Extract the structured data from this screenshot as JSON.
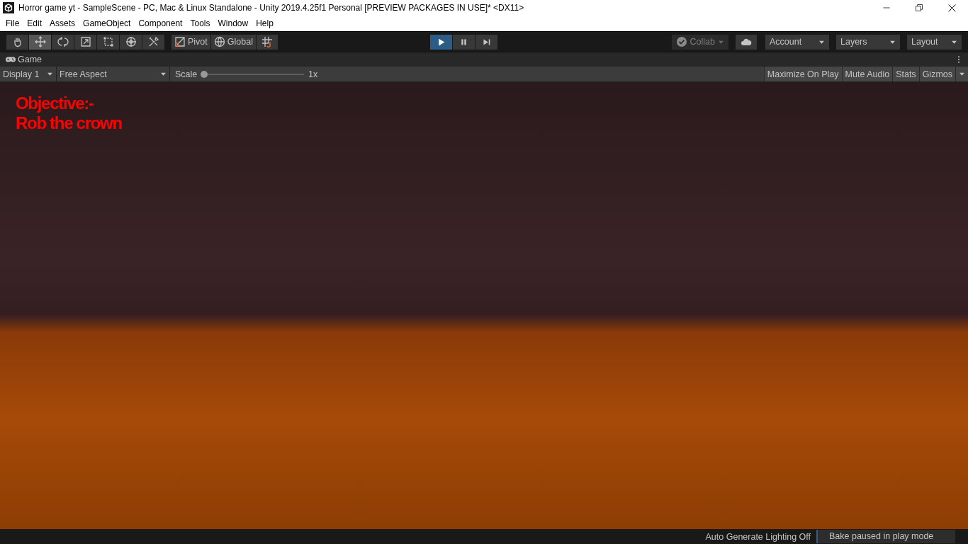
{
  "window": {
    "title": "Horror game yt - SampleScene - PC, Mac & Linux Standalone - Unity 2019.4.25f1 Personal [PREVIEW PACKAGES IN USE]* <DX11>"
  },
  "menu": [
    "File",
    "Edit",
    "Assets",
    "GameObject",
    "Component",
    "Tools",
    "Window",
    "Help"
  ],
  "tools": [
    {
      "kind": "hand",
      "selected": false
    },
    {
      "kind": "move",
      "selected": true
    },
    {
      "kind": "rotate",
      "selected": false
    },
    {
      "kind": "scale",
      "selected": false
    },
    {
      "kind": "rect",
      "selected": false
    },
    {
      "kind": "transform",
      "selected": false
    },
    {
      "kind": "custom",
      "selected": false
    }
  ],
  "handles": [
    {
      "kind": "pivot",
      "label": "Pivot"
    },
    {
      "kind": "global",
      "label": "Global"
    },
    {
      "kind": "snap"
    }
  ],
  "playback": [
    {
      "kind": "play",
      "selected": true
    },
    {
      "kind": "pause",
      "selected": false
    },
    {
      "kind": "step",
      "selected": false
    }
  ],
  "right_buttons": [
    {
      "kind": "collab",
      "label": "Collab",
      "disabled": true
    },
    {
      "kind": "cloud"
    },
    {
      "kind": "dropdown",
      "label": "Account"
    },
    {
      "kind": "dropdown",
      "label": "Layers"
    },
    {
      "kind": "dropdown",
      "label": "Layout"
    }
  ],
  "panel": {
    "tab": "Game",
    "display": "Display 1",
    "aspect": "Free Aspect",
    "scale_label": "Scale",
    "scale": {
      "level": 0,
      "reading": "1x"
    },
    "toggles": [
      {
        "label": "Maximize On Play",
        "on": false
      },
      {
        "label": "Mute Audio",
        "on": false
      },
      {
        "label": "Stats",
        "on": false
      },
      {
        "label": "Gizmos",
        "on": false
      }
    ]
  },
  "game": {
    "objective": [
      "Objective:-",
      "Rob the crown"
    ]
  },
  "status_bar": {
    "lighting": "Auto Generate Lighting Off",
    "bake": "Bake paused in play mode"
  }
}
